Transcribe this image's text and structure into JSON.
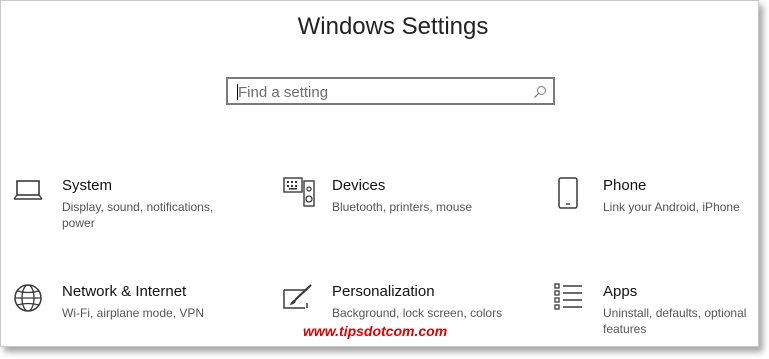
{
  "window": {
    "title": "Windows Settings"
  },
  "search": {
    "placeholder": "Find a setting",
    "icon": "search-icon"
  },
  "categories": [
    {
      "name": "System",
      "description": "Display, sound, notifications, power",
      "icon": "laptop-icon"
    },
    {
      "name": "Devices",
      "description": "Bluetooth, printers, mouse",
      "icon": "devices-icon"
    },
    {
      "name": "Phone",
      "description": "Link your Android, iPhone",
      "icon": "phone-icon"
    },
    {
      "name": "Network & Internet",
      "description": "Wi-Fi, airplane mode, VPN",
      "icon": "globe-icon"
    },
    {
      "name": "Personalization",
      "description": "Background, lock screen, colors",
      "icon": "paintbrush-icon"
    },
    {
      "name": "Apps",
      "description": "Uninstall, defaults, optional features",
      "icon": "apps-list-icon"
    }
  ],
  "watermark": "www.tipsdotcom.com",
  "colors": {
    "icon": "#3a3a3a",
    "watermark": "#e00000",
    "search_border": "#7a7a7a"
  }
}
